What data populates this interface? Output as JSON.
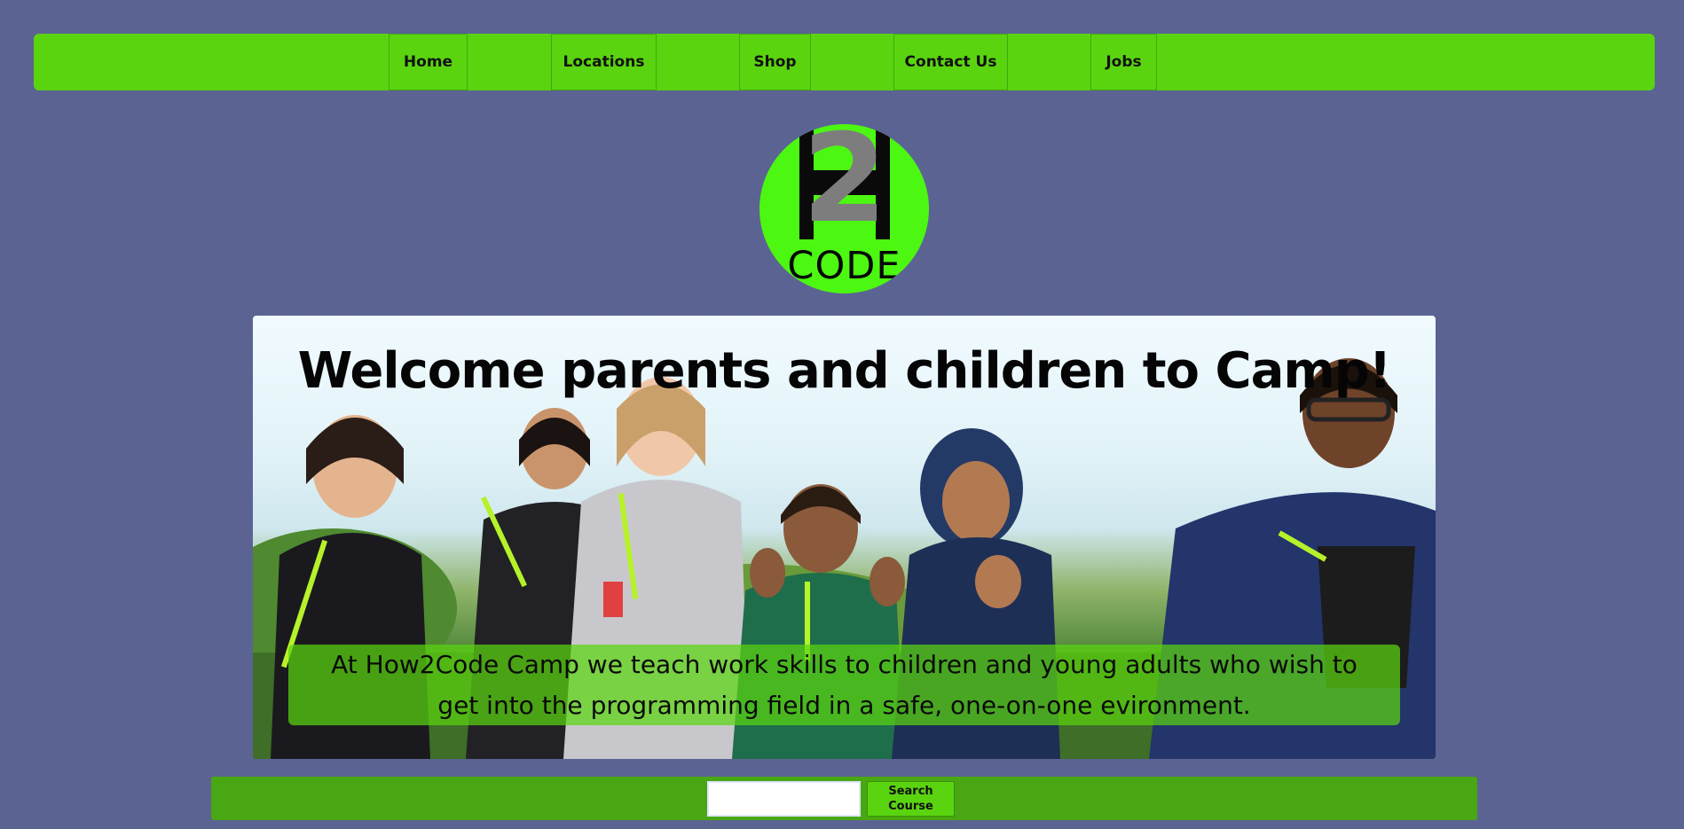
{
  "nav": {
    "items": [
      {
        "label": "Home"
      },
      {
        "label": "Locations"
      },
      {
        "label": "Shop"
      },
      {
        "label": "Contact Us"
      },
      {
        "label": "Jobs"
      }
    ]
  },
  "logo": {
    "mark": "2",
    "text": "CODE"
  },
  "hero": {
    "title": "Welcome parents and children to Camp!",
    "caption": "At How2Code Camp we teach work skills to children and young adults who wish to get into the programming field in a safe, one-on-one evironment."
  },
  "search": {
    "input_value": "",
    "button_label": "Search Course"
  },
  "colors": {
    "background": "#5b6393",
    "nav": "#5ad40f",
    "search_bar": "#48a712",
    "logo_green": "#4cf712"
  }
}
